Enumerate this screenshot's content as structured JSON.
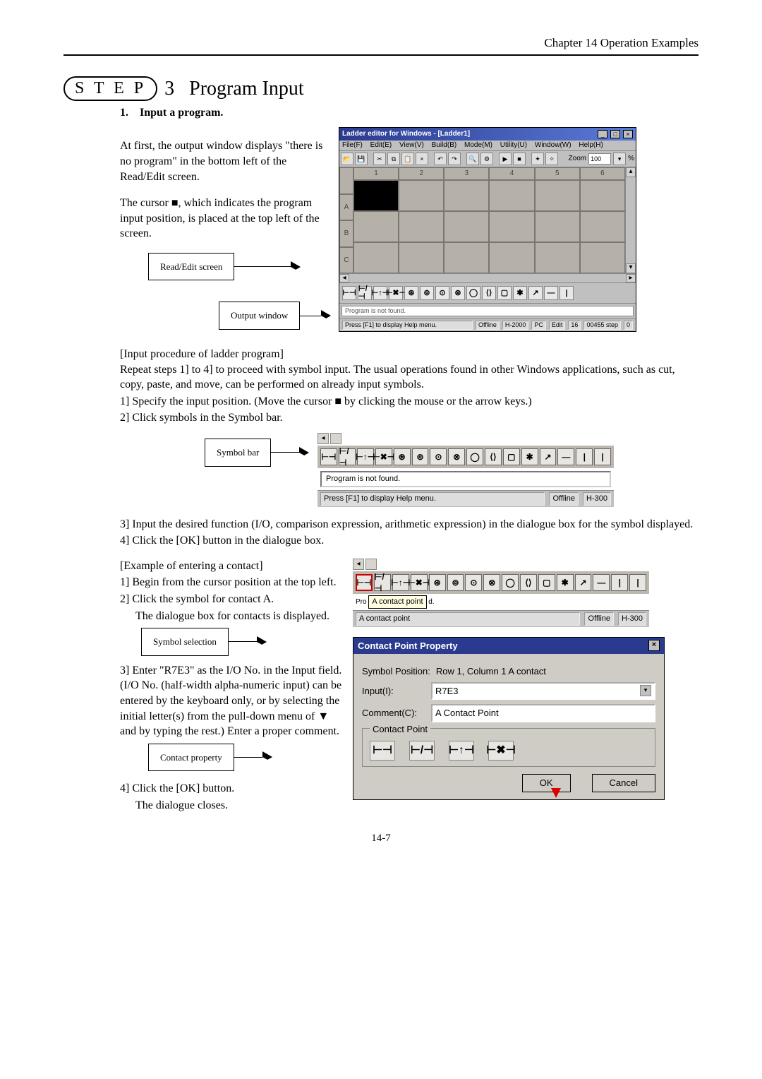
{
  "chapter_header": "Chapter 14  Operation Examples",
  "step": {
    "badge": "S T E P",
    "number": "3",
    "title": "Program Input"
  },
  "substep1": {
    "num": "1.",
    "title": "Input a program."
  },
  "intro": {
    "p1a": "At first, the output window displays \"there is no program\" in the bottom left of the Read/Edit screen.",
    "p1b": "The cursor ■, which indicates the program input position, is placed at the top left of the screen."
  },
  "callouts": {
    "read_edit": "Read/Edit screen",
    "output_window": "Output window",
    "symbol_bar": "Symbol bar",
    "symbol_selection": "Symbol selection",
    "contact_property": "Contact property"
  },
  "ladder_window": {
    "title": "Ladder editor for Windows - [Ladder1]",
    "menu": [
      "File(F)",
      "Edit(E)",
      "View(V)",
      "Build(B)",
      "Mode(M)",
      "Utility(U)",
      "Window(W)",
      "Help(H)"
    ],
    "zoom_label": "Zoom",
    "zoom_value": "100",
    "zoom_pct": "%",
    "col_headers": [
      "1",
      "2",
      "3",
      "4",
      "5",
      "6"
    ],
    "row_labels": [
      "A",
      "B",
      "C"
    ],
    "output_text": "Program is not found.",
    "status_help": "Press [F1] to display Help menu.",
    "status_mode": "Offline",
    "status_model": "H-2000",
    "status_pc": "PC",
    "status_edit": "Edit",
    "status_cols": "16",
    "status_steps": "00455 step",
    "status_zero": "0"
  },
  "proc_heading": "[Input procedure of ladder program]",
  "proc_intro": "Repeat steps 1] to 4] to proceed with symbol input. The usual operations found in other Windows applications, such as cut, copy, paste, and move, can be performed on already input symbols.",
  "proc": {
    "s1": "1]   Specify the input position. (Move the cursor ■ by clicking the mouse or the arrow keys.)",
    "s2": "2]   Click symbols in the Symbol bar."
  },
  "sbar_fig": {
    "output_text": "Program is not found.",
    "status_help": "Press [F1] to display Help menu.",
    "status_mode": "Offline",
    "status_model": "H-300"
  },
  "proc2": {
    "s3": "3]   Input the desired function (I/O, comparison expression, arithmetic expression) in the dialogue box for the symbol displayed.",
    "s4": "4]   Click the [OK] button in the dialogue box."
  },
  "example_heading": "[Example of entering a contact]",
  "example": {
    "s1": "1]   Begin from the cursor position at the top left.",
    "s2": "2]   Click the symbol for contact A.",
    "s2b": "The dialogue box for contacts is displayed.",
    "s3": "3]   Enter \"R7E3\" as the I/O No. in the Input field. (I/O No. (half-width alpha-numeric input) can be entered by the keyboard only, or by selecting the initial letter(s) from the pull-down menu of ▼ and by typing the rest.) Enter a proper comment.",
    "s4": "4]   Click the [OK] button.",
    "s4b": "The dialogue closes."
  },
  "tooltip": "A contact point",
  "status2_text": "A contact point",
  "status2_mode": "Offline",
  "status2_model": "H-300",
  "dialog": {
    "title": "Contact Point Property",
    "pos_label": "Symbol Position:",
    "pos_value": "Row 1, Column 1   A contact",
    "input_label": "Input(I):",
    "input_value": "R7E3",
    "comment_label": "Comment(C):",
    "comment_value": "A Contact Point",
    "fieldset_label": "Contact Point",
    "ok": "OK",
    "cancel": "Cancel",
    "symbols": [
      "⊢⊣",
      "⊢/⊣",
      "⊢↑⊣",
      "⊢✖⊣"
    ]
  },
  "symbol_glyphs": [
    "⊢⊣",
    "⊢/⊣",
    "⊢↑⊣",
    "⊢✖⊣",
    "⊛",
    "⊚",
    "⊙",
    "⊗",
    "◯",
    "⟨⟩",
    "▢",
    "✱",
    "↗",
    "—",
    "|",
    "|"
  ],
  "page_number": "14-7"
}
